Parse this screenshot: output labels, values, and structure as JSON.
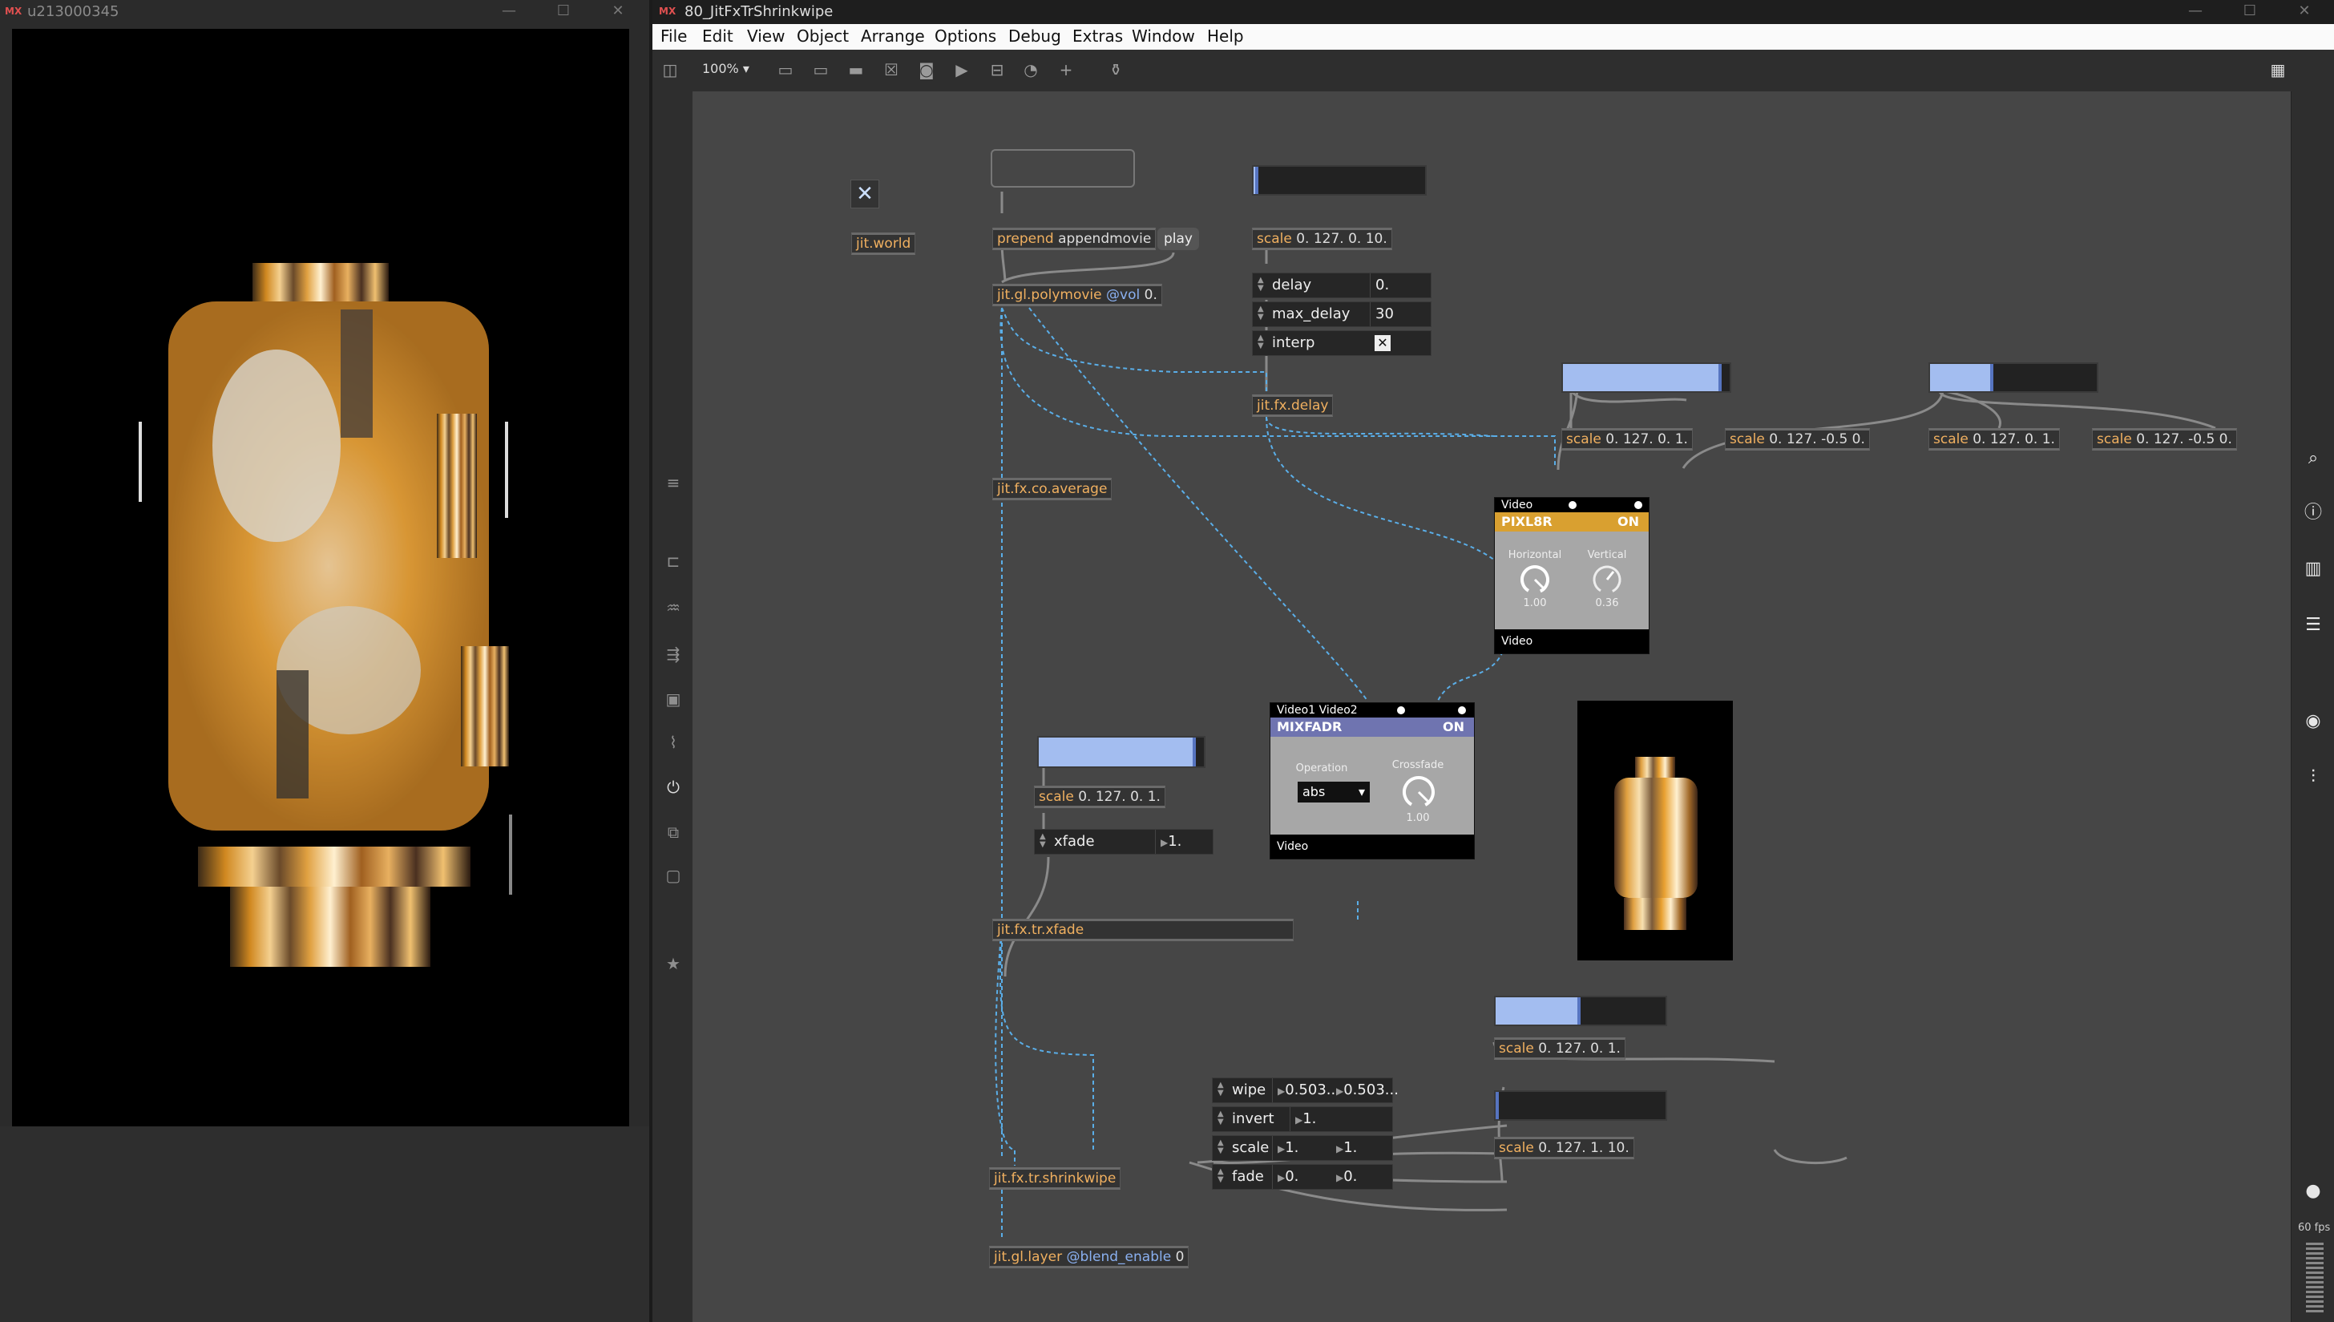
{
  "render_window": {
    "title": "u213000345",
    "controls": [
      "—",
      "☐",
      "✕"
    ]
  },
  "max_window": {
    "app_badge": "MX",
    "title": "80_JitFxTrShrinkwipe",
    "controls": [
      "—",
      "☐",
      "✕"
    ],
    "menu": [
      "File",
      "Edit",
      "View",
      "Object",
      "Arrange",
      "Options",
      "Debug",
      "Extras",
      "Window",
      "Help"
    ],
    "zoom": "100%",
    "fps": "60 fps"
  },
  "patch": {
    "toggle_glyph": "✕",
    "jit_world": "jit.world",
    "prepend": {
      "name": "prepend",
      "arg": "appendmovie"
    },
    "play_msg": "play",
    "polymovie": {
      "name": "jit.gl.polymovie",
      "attr": "@vol",
      "arg": "0."
    },
    "scale_delay": {
      "name": "scale",
      "arg": "0. 127. 0. 10."
    },
    "attr_delay": {
      "label": "delay",
      "value": "0."
    },
    "attr_max_delay": {
      "label": "max_delay",
      "value": "30"
    },
    "attr_interp": {
      "label": "interp",
      "value": "✕"
    },
    "fx_delay": "jit.fx.delay",
    "co_average": "jit.fx.co.average",
    "scale_p1": {
      "name": "scale",
      "arg": "0. 127. 0. 1."
    },
    "scale_p2": {
      "name": "scale",
      "arg": "0. 127. -0.5 0."
    },
    "scale_p3": {
      "name": "scale",
      "arg": "0. 127. 0. 1."
    },
    "scale_p4": {
      "name": "scale",
      "arg": "0. 127. -0.5 0."
    },
    "pixl8r": {
      "hdr": "Video",
      "title": "PIXL8R",
      "state": "ON",
      "h_label": "Horizontal",
      "h_value": "1.00",
      "v_label": "Vertical",
      "v_value": "0.36",
      "footer": "Video"
    },
    "mixfadr": {
      "hdr": "Video1   Video2",
      "title": "MIXFADR",
      "state": "ON",
      "op_label": "Operation",
      "op_value": "abs",
      "cf_label": "Crossfade",
      "cf_value": "1.00",
      "footer": "Video"
    },
    "scale_xfade": {
      "name": "scale",
      "arg": "0. 127. 0. 1."
    },
    "attr_xfade": {
      "label": "xfade",
      "value": "1."
    },
    "tr_xfade": "jit.fx.tr.xfade",
    "scale_wipe": {
      "name": "scale",
      "arg": "0. 127. 0. 1."
    },
    "scale_scale": {
      "name": "scale",
      "arg": "0. 127. 1. 10."
    },
    "attr_wipe": {
      "label": "wipe",
      "v1": "0.503...",
      "v2": "0.503..."
    },
    "attr_invert": {
      "label": "invert",
      "v1": "1."
    },
    "attr_scale": {
      "label": "scale",
      "v1": "1.",
      "v2": "1."
    },
    "attr_fade": {
      "label": "fade",
      "v1": "0.",
      "v2": "0."
    },
    "shrinkwipe": "jit.fx.tr.shrinkwipe",
    "gl_layer": {
      "name": "jit.gl.layer",
      "attr": "@blend_enable",
      "arg": "0"
    }
  },
  "sliders": {
    "delay": 0.03,
    "pixl8r_h": 0.95,
    "pixl8r_v": 0.38,
    "xfade": 0.95,
    "wipe": 0.5,
    "scale": 0.02
  },
  "colors": {
    "object_text": "#f0b060",
    "slider_fill": "#a3bdf0",
    "pixl8r_title": "#d9a030",
    "mixfadr_title": "#6f74b0",
    "patch_cord_video": "#5aaee8"
  }
}
